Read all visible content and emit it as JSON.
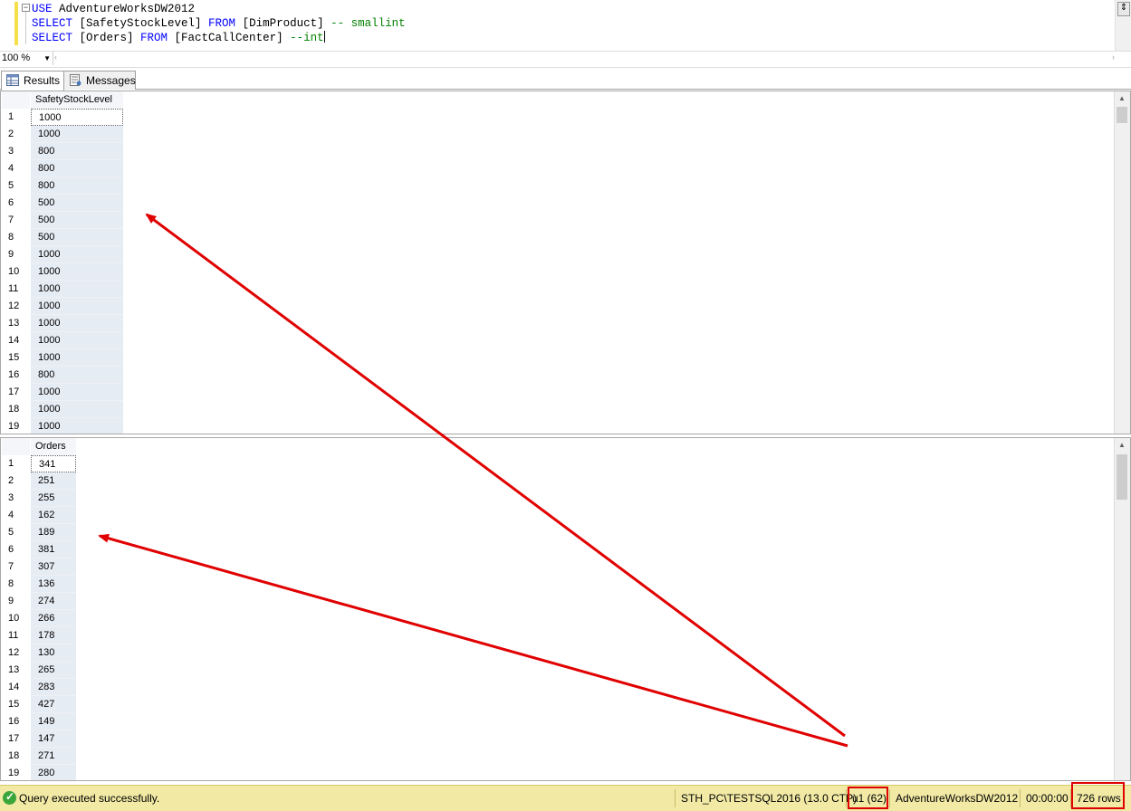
{
  "editor": {
    "line1": {
      "kw": "USE",
      "rest": " AdventureWorksDW2012"
    },
    "line2": {
      "kw1": "SELECT",
      "a": " [SafetyStockLevel] ",
      "kw2": "FROM",
      "b": " [DimProduct] ",
      "comment": "-- smallint"
    },
    "line3": {
      "kw1": "SELECT",
      "a": " [Orders] ",
      "kw2": "FROM",
      "b": " [FactCallCenter] ",
      "comment": "--int"
    },
    "collapse_glyph": "−"
  },
  "zoom": {
    "value": "100 %"
  },
  "tabs": [
    {
      "label": "Results",
      "icon": "grid-icon",
      "active": true
    },
    {
      "label": "Messages",
      "icon": "messages-icon",
      "active": false
    }
  ],
  "grid1": {
    "column": "SafetyStockLevel",
    "rows": [
      "1000",
      "1000",
      "800",
      "800",
      "800",
      "500",
      "500",
      "500",
      "1000",
      "1000",
      "1000",
      "1000",
      "1000",
      "1000",
      "1000",
      "800",
      "1000",
      "1000",
      "1000"
    ]
  },
  "grid2": {
    "column": "Orders",
    "rows": [
      "341",
      "251",
      "255",
      "162",
      "189",
      "381",
      "307",
      "136",
      "274",
      "266",
      "178",
      "130",
      "265",
      "283",
      "427",
      "149",
      "147",
      "271",
      "280"
    ]
  },
  "status": {
    "message": "Query executed successfully.",
    "server": "STH_PC\\TESTSQL2016 (13.0 CTP)",
    "user": "u1 (62)",
    "database": "AdventureWorksDW2012",
    "time": "00:00:00",
    "rows": "726 rows"
  },
  "colors": {
    "annotation": "#e00000",
    "status_bg": "#f1e9a4",
    "keyword": "#0000ff",
    "comment": "#008000"
  }
}
